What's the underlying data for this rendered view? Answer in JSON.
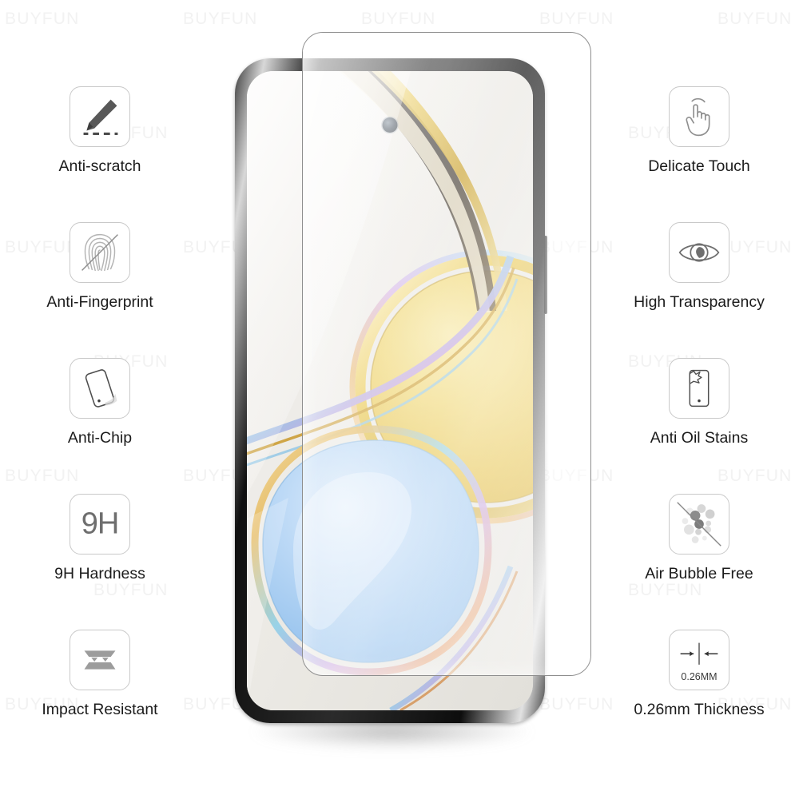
{
  "product": {
    "type": "tempered-glass-screen-protector",
    "watermark_text": "BUYFUN"
  },
  "features_left": [
    {
      "id": "anti-scratch",
      "icon": "pencil-scratch-icon",
      "label": "Anti-scratch"
    },
    {
      "id": "anti-fingerprint",
      "icon": "fingerprint-slash-icon",
      "label": "Anti-Fingerprint"
    },
    {
      "id": "anti-chip",
      "icon": "phone-chip-icon",
      "label": "Anti-Chip"
    },
    {
      "id": "9h-hardness",
      "icon": "hardness-9h-icon",
      "label": "9H Hardness",
      "icon_text": "9H"
    },
    {
      "id": "impact-resistant",
      "icon": "impact-layers-icon",
      "label": "Impact Resistant"
    }
  ],
  "features_right": [
    {
      "id": "delicate-touch",
      "icon": "hand-tap-icon",
      "label": "Delicate Touch"
    },
    {
      "id": "high-transparency",
      "icon": "eye-icon",
      "label": "High Transparency"
    },
    {
      "id": "anti-oil-stains",
      "icon": "phone-stain-icon",
      "label": "Anti Oil Stains"
    },
    {
      "id": "air-bubble-free",
      "icon": "bubbles-slash-icon",
      "label": "Air Bubble Free"
    },
    {
      "id": "thickness",
      "icon": "thickness-arrows-icon",
      "label": "0.26mm Thickness",
      "icon_text": "0.26MM"
    }
  ],
  "colors": {
    "icon_border": "#c9c9c9",
    "icon_gray": "#6e6e6e",
    "label_text": "#1b1b1b",
    "watermark": "#f2f2f2",
    "wallpaper_gold": "#e8c64a",
    "wallpaper_blue": "#a9cdf2",
    "phone_bezel": "#101010"
  },
  "wallpaper": {
    "description": "abstract gold circle upper-right, blue rounded-square lower-left, iridescent rims",
    "background": "#eceae6"
  }
}
